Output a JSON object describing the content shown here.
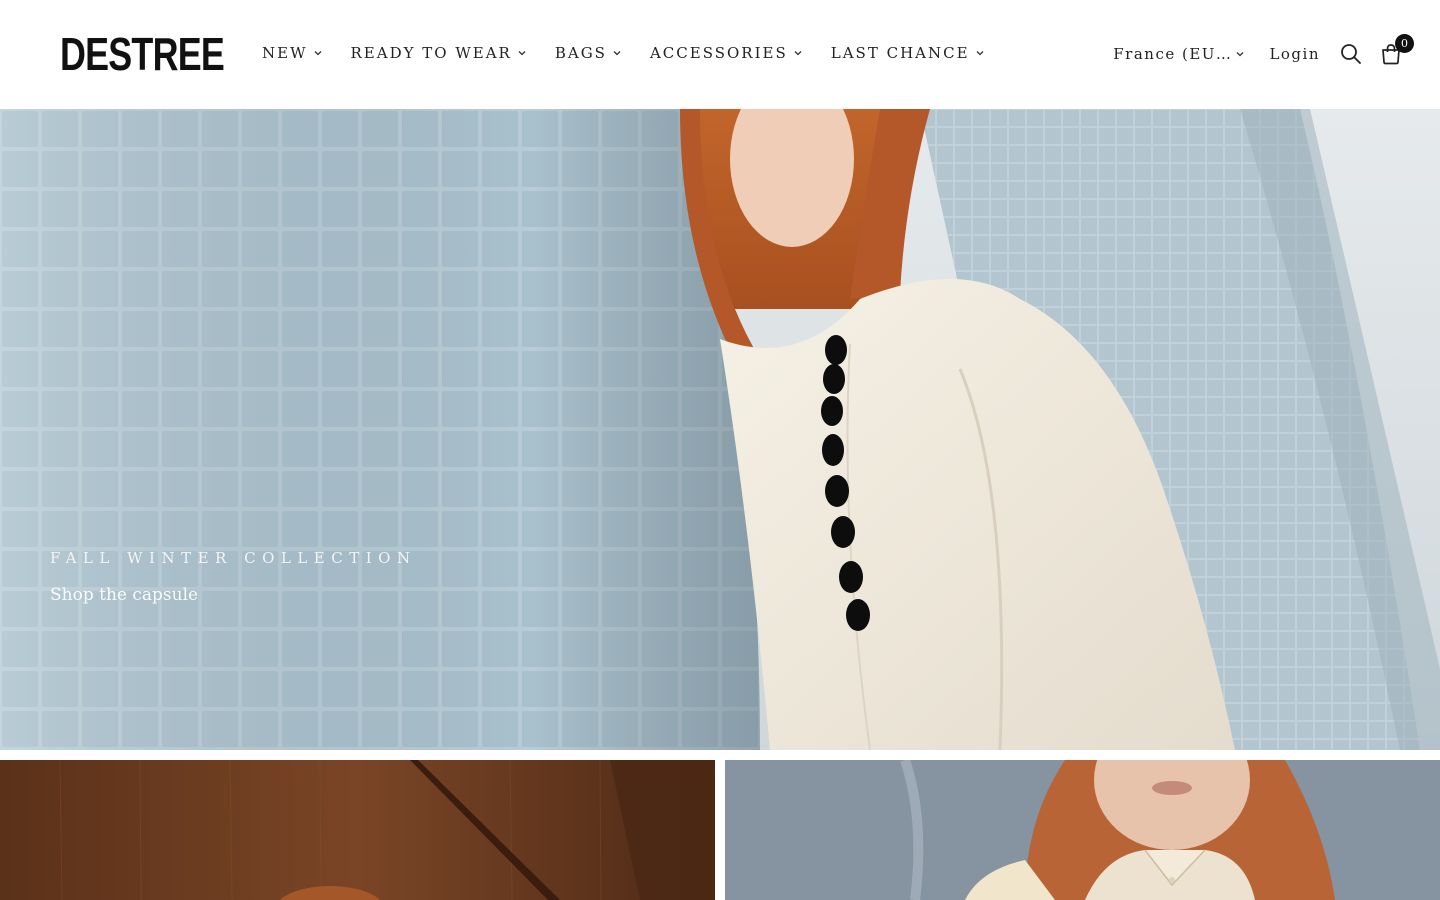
{
  "brand": {
    "logo_text": "DESTREE"
  },
  "nav": {
    "items": [
      {
        "label": "NEW"
      },
      {
        "label": "READY TO WEAR"
      },
      {
        "label": "BAGS"
      },
      {
        "label": "ACCESSORIES"
      },
      {
        "label": "LAST CHANCE"
      }
    ]
  },
  "utility": {
    "country": "France (EU…",
    "login": "Login",
    "cart_count": "0",
    "icons": [
      "search-icon",
      "cart-icon",
      "chevron-down-icon"
    ]
  },
  "hero": {
    "eyebrow": "FALL WINTER COLLECTION",
    "link": "Shop the capsule"
  },
  "colors": {
    "text": "#1a1a1a",
    "header_bg": "#ffffff",
    "tile_blue": "#b9cfd9",
    "coat_cream": "#f2ece0",
    "button_black": "#0d0d0d",
    "wood_brown": "#6b3c22"
  }
}
